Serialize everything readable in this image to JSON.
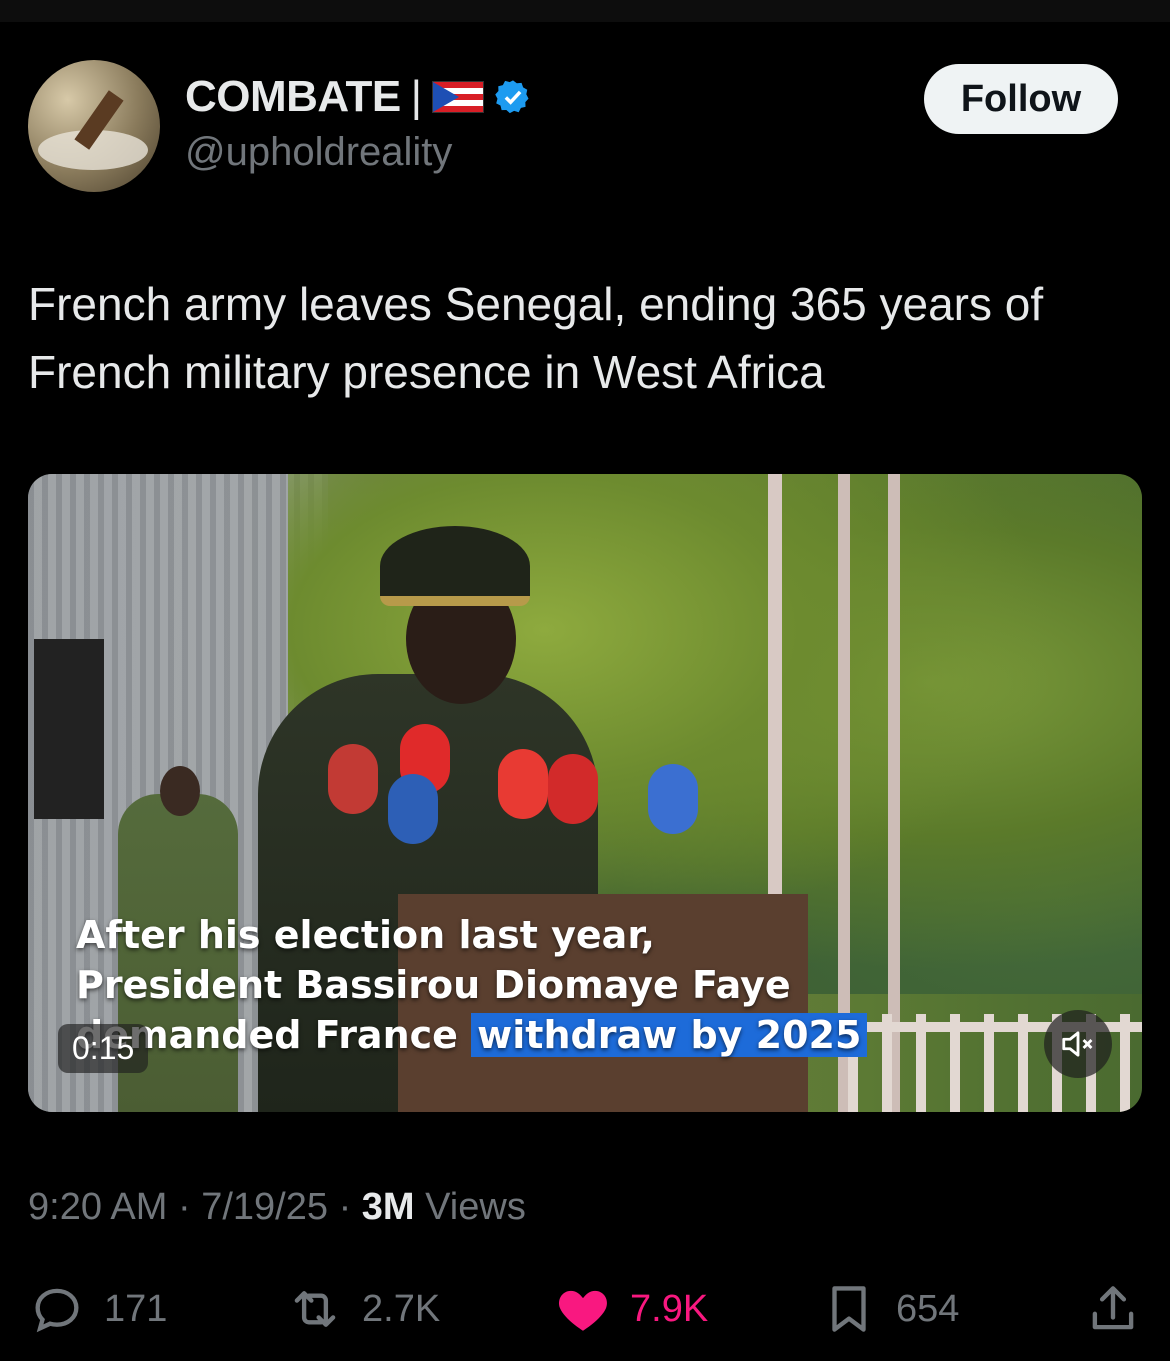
{
  "author": {
    "name": "COMBATE",
    "separator": "|",
    "handle": "@upholdreality",
    "verified": true
  },
  "follow_label": "Follow",
  "tweet": {
    "text": "French army leaves Senegal, ending 365 years of French military presence in West Africa"
  },
  "video": {
    "caption_line1": "After his election last year,",
    "caption_line2": "President Bassirou Diomaye Faye",
    "caption_line3a": "demanded France",
    "caption_line3b": "withdraw by 2025",
    "timer": "0:15",
    "muted": true
  },
  "meta": {
    "time": "9:20 AM",
    "dot1": "·",
    "date": "7/19/25",
    "dot2": "·",
    "views_count": "3M",
    "views_label": "Views"
  },
  "actions": {
    "replies": "171",
    "reposts": "2.7K",
    "likes": "7.9K",
    "bookmarks": "654"
  },
  "colors": {
    "background": "#000000",
    "text": "#e7e9ea",
    "muted_text": "#71767b",
    "like": "#f91880",
    "verified": "#1d9bf0",
    "caption_highlight": "#1d6bd9"
  }
}
